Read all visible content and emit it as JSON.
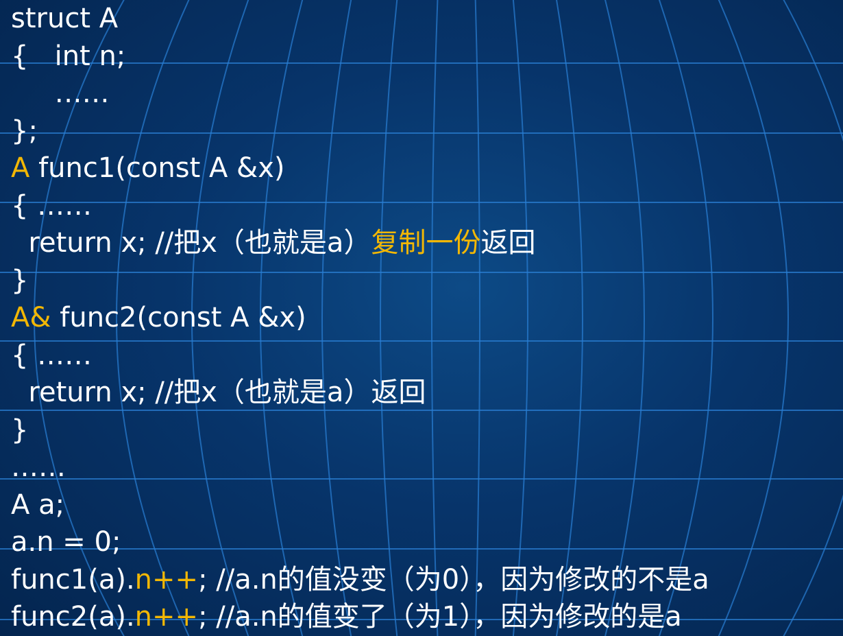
{
  "slide": {
    "background_color": "#06305f",
    "grid_color": "#2a7fd4",
    "text_color": "#ffffff",
    "highlight_color": "#f2b705",
    "lines": [
      [
        {
          "t": "struct A"
        }
      ],
      [
        {
          "t": "{   int n;"
        }
      ],
      [
        {
          "t": "     ……"
        }
      ],
      [
        {
          "t": "};"
        }
      ],
      [
        {
          "t": "A",
          "hl": true
        },
        {
          "t": " func1(const A &x)"
        }
      ],
      [
        {
          "t": "{ ……"
        }
      ],
      [
        {
          "t": "  return x; //把x（也就是a）"
        },
        {
          "t": "复制一份",
          "hl": true
        },
        {
          "t": "返回"
        }
      ],
      [
        {
          "t": "}"
        }
      ],
      [
        {
          "t": "A&",
          "hl": true
        },
        {
          "t": " func2(const A &x)"
        }
      ],
      [
        {
          "t": "{ ……"
        }
      ],
      [
        {
          "t": "  return x; //把x（也就是a）返回"
        }
      ],
      [
        {
          "t": "}"
        }
      ],
      [
        {
          "t": "……"
        }
      ],
      [
        {
          "t": "A a;"
        }
      ],
      [
        {
          "t": "a.n = 0;"
        }
      ],
      [
        {
          "t": "func1(a)."
        },
        {
          "t": "n++",
          "hl": true
        },
        {
          "t": "; //a.n的值没变（为0），因为修改的不是a"
        }
      ],
      [
        {
          "t": "func2(a)."
        },
        {
          "t": "n++",
          "hl": true
        },
        {
          "t": "; //a.n的值变了（为1），因为修改的是a"
        }
      ]
    ]
  }
}
